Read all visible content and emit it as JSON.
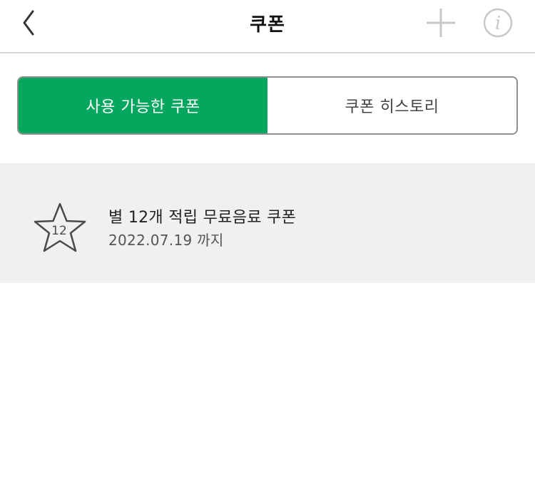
{
  "header": {
    "title": "쿠폰",
    "back_icon": "chevron-left-icon",
    "add_icon": "plus-icon",
    "info_icon": "info-icon"
  },
  "tabs": [
    {
      "label": "사용 가능한 쿠폰",
      "active": true
    },
    {
      "label": "쿠폰 히스토리",
      "active": false
    }
  ],
  "coupons": [
    {
      "icon": "star-icon",
      "star_count": "12",
      "name": "별 12개 적립 무료음료 쿠폰",
      "expiry": "2022.07.19 까지"
    }
  ],
  "colors": {
    "accent": "#05a75e",
    "list_background": "#f0f0ee",
    "header_icons": "#c8c8c8"
  }
}
